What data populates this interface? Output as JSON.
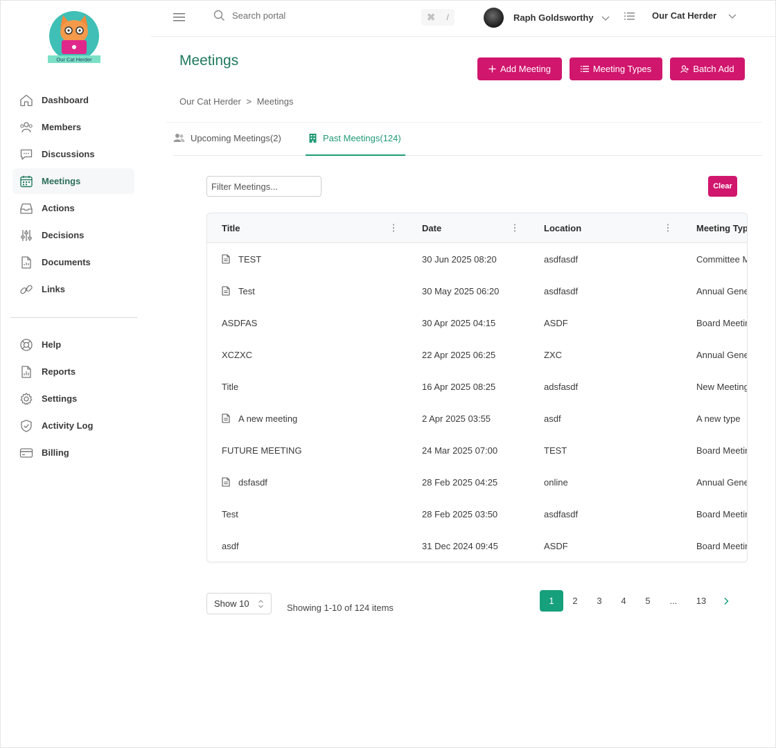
{
  "brand": {
    "logo_text": "Our Cat Herder",
    "accent": "#d0166d",
    "primary_green": "#1f9a74"
  },
  "sidebar": {
    "items": [
      {
        "label": "Dashboard",
        "icon": "home-icon",
        "active": false
      },
      {
        "label": "Members",
        "icon": "members-icon",
        "active": false
      },
      {
        "label": "Discussions",
        "icon": "chat-icon",
        "active": false
      },
      {
        "label": "Meetings",
        "icon": "calendar-icon",
        "active": true
      },
      {
        "label": "Actions",
        "icon": "inbox-icon",
        "active": false
      },
      {
        "label": "Decisions",
        "icon": "sliders-icon",
        "active": false
      },
      {
        "label": "Documents",
        "icon": "document-icon",
        "active": false
      },
      {
        "label": "Links",
        "icon": "link-icon",
        "active": false
      }
    ],
    "secondary_items": [
      {
        "label": "Help",
        "icon": "lifebuoy-icon"
      },
      {
        "label": "Reports",
        "icon": "report-icon"
      },
      {
        "label": "Settings",
        "icon": "gear-icon"
      },
      {
        "label": "Activity Log",
        "icon": "shield-icon"
      },
      {
        "label": "Billing",
        "icon": "credit-card-icon"
      }
    ]
  },
  "topbar": {
    "search_placeholder": "Search portal",
    "shortcut_symbol": "⌘",
    "shortcut_key": "/",
    "user_name": "Raph Goldsworthy",
    "org_name": "Our Cat Herder"
  },
  "header": {
    "title": "Meetings",
    "add_meeting_label": "Add Meeting",
    "meeting_types_label": "Meeting Types",
    "batch_add_label": "Batch Add",
    "breadcrumb": [
      "Our Cat Herder",
      ">",
      "Meetings"
    ]
  },
  "tabs": [
    {
      "label": "Upcoming Meetings(2)",
      "active": false
    },
    {
      "label": "Past Meetings(124)",
      "active": true
    }
  ],
  "filter": {
    "placeholder": "Filter Meetings...",
    "clear_label": "Clear"
  },
  "table": {
    "columns": [
      "Title",
      "Date",
      "Location",
      "Meeting Typ"
    ],
    "rows": [
      {
        "has_doc": true,
        "title": "TEST",
        "date": "30 Jun 2025 08:20",
        "location": "asdfasdf",
        "type": "Committee M"
      },
      {
        "has_doc": true,
        "title": "Test",
        "date": "30 May 2025 06:20",
        "location": "asdfasdf",
        "type": "Annual Gener"
      },
      {
        "has_doc": false,
        "title": "ASDFAS",
        "date": "30 Apr 2025 04:15",
        "location": "ASDF",
        "type": "Board Meetin"
      },
      {
        "has_doc": false,
        "title": "XCZXC",
        "date": "22 Apr 2025 06:25",
        "location": "ZXC",
        "type": "Annual Gener"
      },
      {
        "has_doc": false,
        "title": "Title",
        "date": "16 Apr 2025 08:25",
        "location": "adsfasdf",
        "type": "New Meeting"
      },
      {
        "has_doc": true,
        "title": "A new meeting",
        "date": "2 Apr 2025 03:55",
        "location": "asdf",
        "type": "A new type"
      },
      {
        "has_doc": false,
        "title": "FUTURE MEETING",
        "date": "24 Mar 2025 07:00",
        "location": "TEST",
        "type": "Board Meetin"
      },
      {
        "has_doc": true,
        "title": "dsfasdf",
        "date": "28 Feb 2025 04:25",
        "location": "online",
        "type": "Annual Gener"
      },
      {
        "has_doc": false,
        "title": "Test",
        "date": "28 Feb 2025 03:50",
        "location": "asdfasdf",
        "type": "Board Meetin"
      },
      {
        "has_doc": false,
        "title": "asdf",
        "date": "31 Dec 2024 09:45",
        "location": "ASDF",
        "type": "Board Meetin"
      }
    ]
  },
  "footer": {
    "page_size_label": "Show 10",
    "showing_text": "Showing 1-10 of 124 items",
    "pages": [
      "1",
      "2",
      "3",
      "4",
      "5",
      "...",
      "13"
    ],
    "current_page": "1"
  }
}
